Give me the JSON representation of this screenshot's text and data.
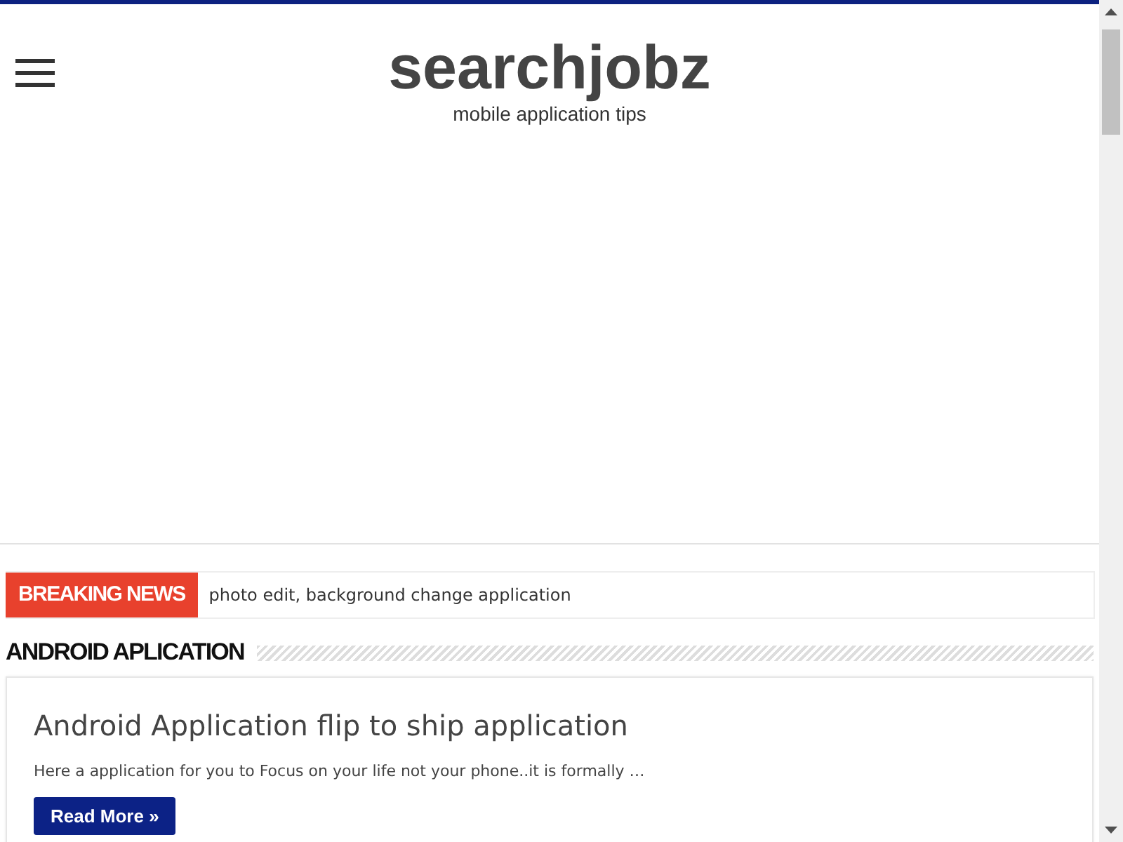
{
  "site": {
    "title": "searchjobz",
    "tagline": "mobile application tips"
  },
  "breaking": {
    "label": "BREAKING NEWS",
    "headline": "photo edit, background change application"
  },
  "section": {
    "title": "ANDROID APLICATION"
  },
  "posts": [
    {
      "title": "Android Application flip to ship application",
      "excerpt": "Here a application for you to Focus on your life not your phone..it is formally …",
      "button": "Read More »"
    }
  ]
}
